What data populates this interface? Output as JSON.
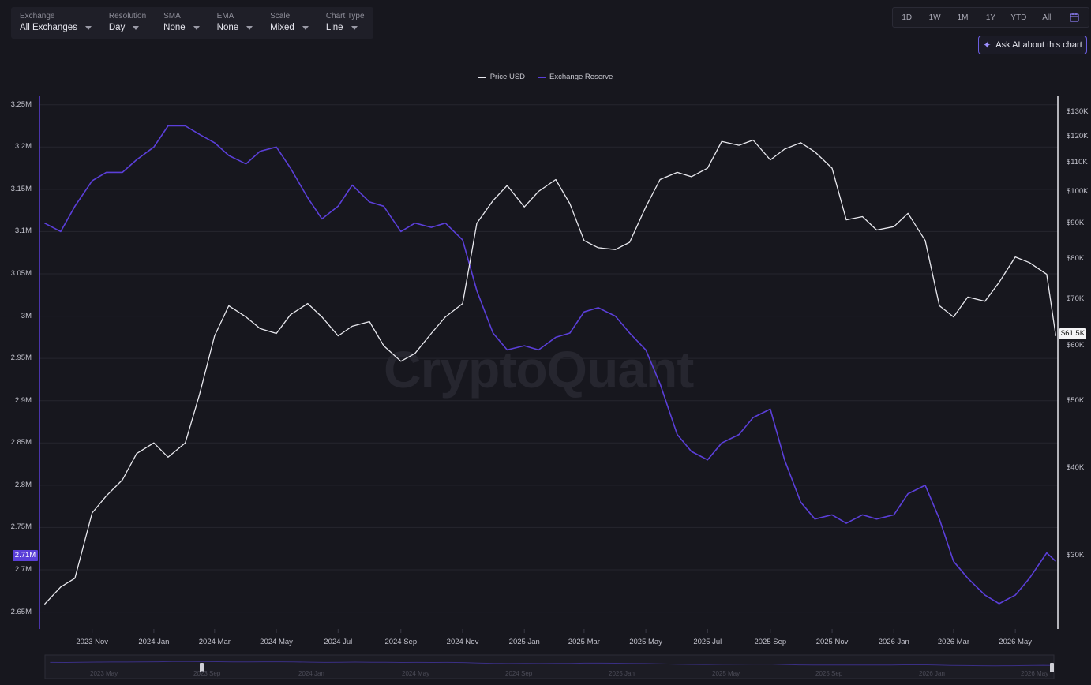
{
  "toolbar": {
    "exchange_label": "Exchange",
    "exchange_value": "All Exchanges",
    "resolution_label": "Resolution",
    "resolution_value": "Day",
    "sma_label": "SMA",
    "sma_value": "None",
    "ema_label": "EMA",
    "ema_value": "None",
    "scale_label": "Scale",
    "scale_value": "Mixed",
    "charttype_label": "Chart Type",
    "charttype_value": "Line"
  },
  "ranges": [
    "1D",
    "1W",
    "1M",
    "1Y",
    "YTD",
    "All"
  ],
  "ask_ai": "Ask AI about this chart",
  "watermark": "CryptoQuant",
  "current": {
    "left": "2.71M",
    "right": "$61.5K"
  },
  "navigator_labels": [
    "2023 May",
    "2023 Sep",
    "2024 Jan",
    "2024 May",
    "2024 Sep",
    "2025 Jan",
    "2025 May",
    "2025 Sep",
    "2026 Jan",
    "2026 May"
  ],
  "colors": {
    "price": "#e8e8ee",
    "reserve": "#5b3fd9",
    "background": "#17171e",
    "grid": "#2a2a34"
  },
  "chart_data": {
    "type": "line",
    "legend": [
      "Price USD",
      "Exchange Reserve"
    ],
    "legend_position": "top-center",
    "x": [
      "2023-09-15",
      "2023-10-01",
      "2023-10-15",
      "2023-11-01",
      "2023-11-15",
      "2023-12-01",
      "2023-12-15",
      "2024-01-01",
      "2024-01-15",
      "2024-02-01",
      "2024-02-15",
      "2024-03-01",
      "2024-03-15",
      "2024-04-01",
      "2024-04-15",
      "2024-05-01",
      "2024-05-15",
      "2024-06-01",
      "2024-06-15",
      "2024-07-01",
      "2024-07-15",
      "2024-08-01",
      "2024-08-15",
      "2024-09-01",
      "2024-09-15",
      "2024-10-01",
      "2024-10-15",
      "2024-11-01",
      "2024-11-15",
      "2024-12-01",
      "2024-12-15",
      "2025-01-01",
      "2025-01-15",
      "2025-02-01",
      "2025-02-15",
      "2025-03-01",
      "2025-03-15",
      "2025-04-01",
      "2025-04-15",
      "2025-05-01",
      "2025-05-15",
      "2025-06-01",
      "2025-06-15",
      "2025-07-01",
      "2025-07-15",
      "2025-08-01",
      "2025-08-15",
      "2025-09-01",
      "2025-09-15",
      "2025-10-01",
      "2025-10-15",
      "2025-11-01",
      "2025-11-15",
      "2025-12-01",
      "2025-12-15",
      "2026-01-01",
      "2026-01-15",
      "2026-02-01",
      "2026-02-15",
      "2026-03-01",
      "2026-03-15",
      "2026-04-01",
      "2026-04-15",
      "2026-05-01",
      "2026-05-15",
      "2026-06-01",
      "2026-06-10"
    ],
    "series": [
      {
        "name": "Price USD",
        "axis": "right",
        "values": [
          25500,
          27000,
          27800,
          34500,
          36500,
          38500,
          42000,
          43500,
          41500,
          43500,
          51000,
          62000,
          68500,
          66000,
          63500,
          62500,
          66500,
          69000,
          66000,
          62000,
          64000,
          65000,
          60000,
          57000,
          58500,
          62500,
          66000,
          69000,
          90000,
          97000,
          102000,
          95000,
          100000,
          104000,
          96000,
          85000,
          83000,
          82500,
          84500,
          95000,
          104000,
          106500,
          105000,
          108000,
          118000,
          116500,
          118500,
          111000,
          115000,
          117500,
          114000,
          108000,
          91000,
          92000,
          88000,
          89000,
          93000,
          85000,
          68500,
          66000,
          70500,
          69500,
          74000,
          80500,
          79000,
          76000,
          62000
        ]
      },
      {
        "name": "Exchange Reserve",
        "axis": "left",
        "values": [
          3110000,
          3100000,
          3130000,
          3160000,
          3170000,
          3170000,
          3185000,
          3200000,
          3225000,
          3225000,
          3215000,
          3205000,
          3190000,
          3180000,
          3195000,
          3200000,
          3175000,
          3140000,
          3115000,
          3130000,
          3155000,
          3135000,
          3130000,
          3100000,
          3110000,
          3105000,
          3110000,
          3090000,
          3030000,
          2980000,
          2960000,
          2965000,
          2960000,
          2975000,
          2980000,
          3005000,
          3010000,
          3000000,
          2980000,
          2960000,
          2920000,
          2860000,
          2840000,
          2830000,
          2850000,
          2860000,
          2880000,
          2890000,
          2830000,
          2780000,
          2760000,
          2765000,
          2755000,
          2765000,
          2760000,
          2765000,
          2790000,
          2800000,
          2760000,
          2710000,
          2690000,
          2670000,
          2660000,
          2670000,
          2690000,
          2720000,
          2710000
        ]
      }
    ],
    "x_tick_labels": [
      "2023 Nov",
      "2024 Jan",
      "2024 Mar",
      "2024 May",
      "2024 Jul",
      "2024 Sep",
      "2024 Nov",
      "2025 Jan",
      "2025 Mar",
      "2025 May",
      "2025 Jul",
      "2025 Sep",
      "2025 Nov",
      "2026 Jan",
      "2026 Mar",
      "2026 May"
    ],
    "x_ticks": [
      "2023-11-01",
      "2024-01-01",
      "2024-03-01",
      "2024-05-01",
      "2024-07-01",
      "2024-09-01",
      "2024-11-01",
      "2025-01-01",
      "2025-03-01",
      "2025-05-01",
      "2025-07-01",
      "2025-09-01",
      "2025-11-01",
      "2026-01-01",
      "2026-03-01",
      "2026-05-01"
    ],
    "xlim": [
      "2023-09-10",
      "2026-06-12"
    ],
    "left_axis": {
      "ticks": [
        2650000,
        2700000,
        2750000,
        2800000,
        2850000,
        2900000,
        2950000,
        3000000,
        3050000,
        3100000,
        3150000,
        3200000,
        3250000
      ],
      "tick_labels": [
        "2.65M",
        "2.7M",
        "2.75M",
        "2.8M",
        "2.85M",
        "2.9M",
        "2.95M",
        "3M",
        "3.05M",
        "3.1M",
        "3.15M",
        "3.2M",
        "3.25M"
      ],
      "ylim": [
        2630000,
        3260000
      ]
    },
    "right_axis": {
      "scale": "log",
      "ticks": [
        30000,
        40000,
        50000,
        60000,
        70000,
        80000,
        90000,
        100000,
        110000,
        120000,
        130000
      ],
      "tick_labels": [
        "$30K",
        "$40K",
        "$50K",
        "$60K",
        "$70K",
        "$80K",
        "$90K",
        "$100K",
        "$110K",
        "$120K",
        "$130K"
      ],
      "ylim": [
        23500,
        137000
      ]
    },
    "grid": true
  }
}
